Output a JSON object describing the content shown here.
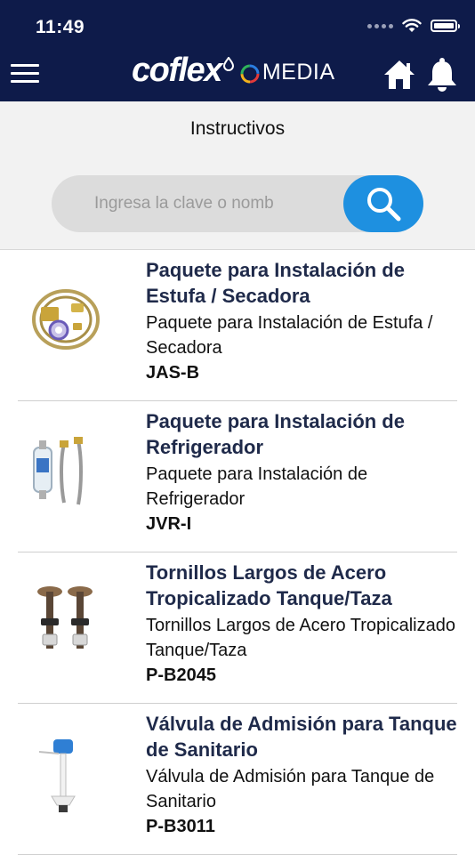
{
  "status_bar": {
    "time": "11:49"
  },
  "header": {
    "brand_name": "coflex",
    "brand_suffix": "MEDIA",
    "menu_icon": "hamburger-menu-icon",
    "home_icon": "home-icon",
    "bell_icon": "bell-icon"
  },
  "page": {
    "title": "Instructivos"
  },
  "search": {
    "placeholder": "Ingresa la clave o nomb",
    "value": "",
    "icon": "search-icon"
  },
  "products": [
    {
      "title": "Paquete para Instalación de Estufa / Secadora",
      "description": "Paquete para Instalación de Estufa / Secadora",
      "code": "JAS-B"
    },
    {
      "title": "Paquete para Instalación de Refrigerador",
      "description": "Paquete para Instalación de Refrigerador",
      "code": "JVR-I"
    },
    {
      "title": "Tornillos Largos de Acero Tropicalizado Tanque/Taza",
      "description": "Tornillos Largos de Acero Tropicalizado Tanque/Taza",
      "code": "P-B2045"
    },
    {
      "title": "Válvula de Admisión para Tanque de Sanitario",
      "description": "Válvula de Admisión para Tanque de Sanitario",
      "code": "P-B3011"
    }
  ],
  "colors": {
    "header_bg": "#0e1b4a",
    "accent": "#1e90e0",
    "title_text": "#1f2a4a"
  }
}
